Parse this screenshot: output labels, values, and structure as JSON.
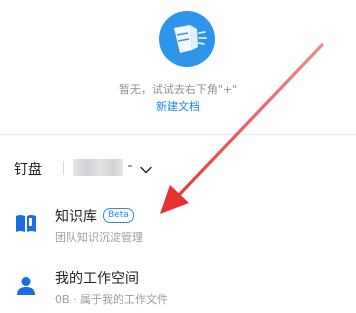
{
  "empty_state": {
    "icon": "folder-fan-icon",
    "message": "暂无，试试去右下角\"+\"",
    "new_doc_label": "新建文档"
  },
  "drive": {
    "title": "钉盘",
    "account_suffix": "-",
    "dropdown_icon": "chevron-down-icon"
  },
  "list": {
    "items": [
      {
        "icon": "book-icon",
        "title": "知识库",
        "badge": "Beta",
        "subtitle": "团队知识沉淀管理"
      },
      {
        "icon": "person-icon",
        "title": "我的工作空间",
        "subtitle": "0B · 属于我的工作文件"
      }
    ]
  },
  "colors": {
    "accent": "#1f84e6",
    "icon_blue": "#1a6fe0",
    "illustration_blue": "#2f95ea",
    "arrow_red": "#e8322f"
  }
}
